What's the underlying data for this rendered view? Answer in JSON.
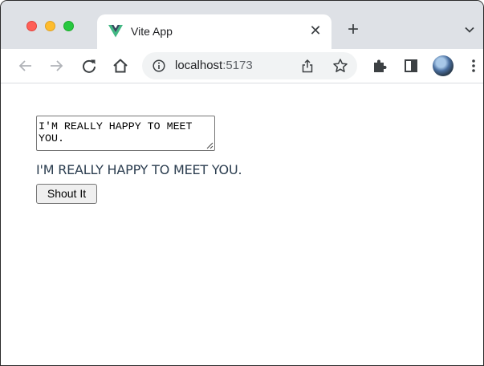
{
  "browser": {
    "tab": {
      "title": "Vite App",
      "favicon": "vue-logo-icon"
    },
    "address": {
      "host": "localhost",
      "port": ":5173"
    }
  },
  "page": {
    "textarea_value": "I'M REALLY HAPPY TO MEET YOU.",
    "output_text": "I'M REALLY HAPPY TO MEET YOU.",
    "button_label": "Shout It"
  },
  "colors": {
    "tabstrip_bg": "#dee1e6",
    "output_text": "#2c3e50",
    "vue_green": "#41b883",
    "vue_dark": "#34495e"
  }
}
